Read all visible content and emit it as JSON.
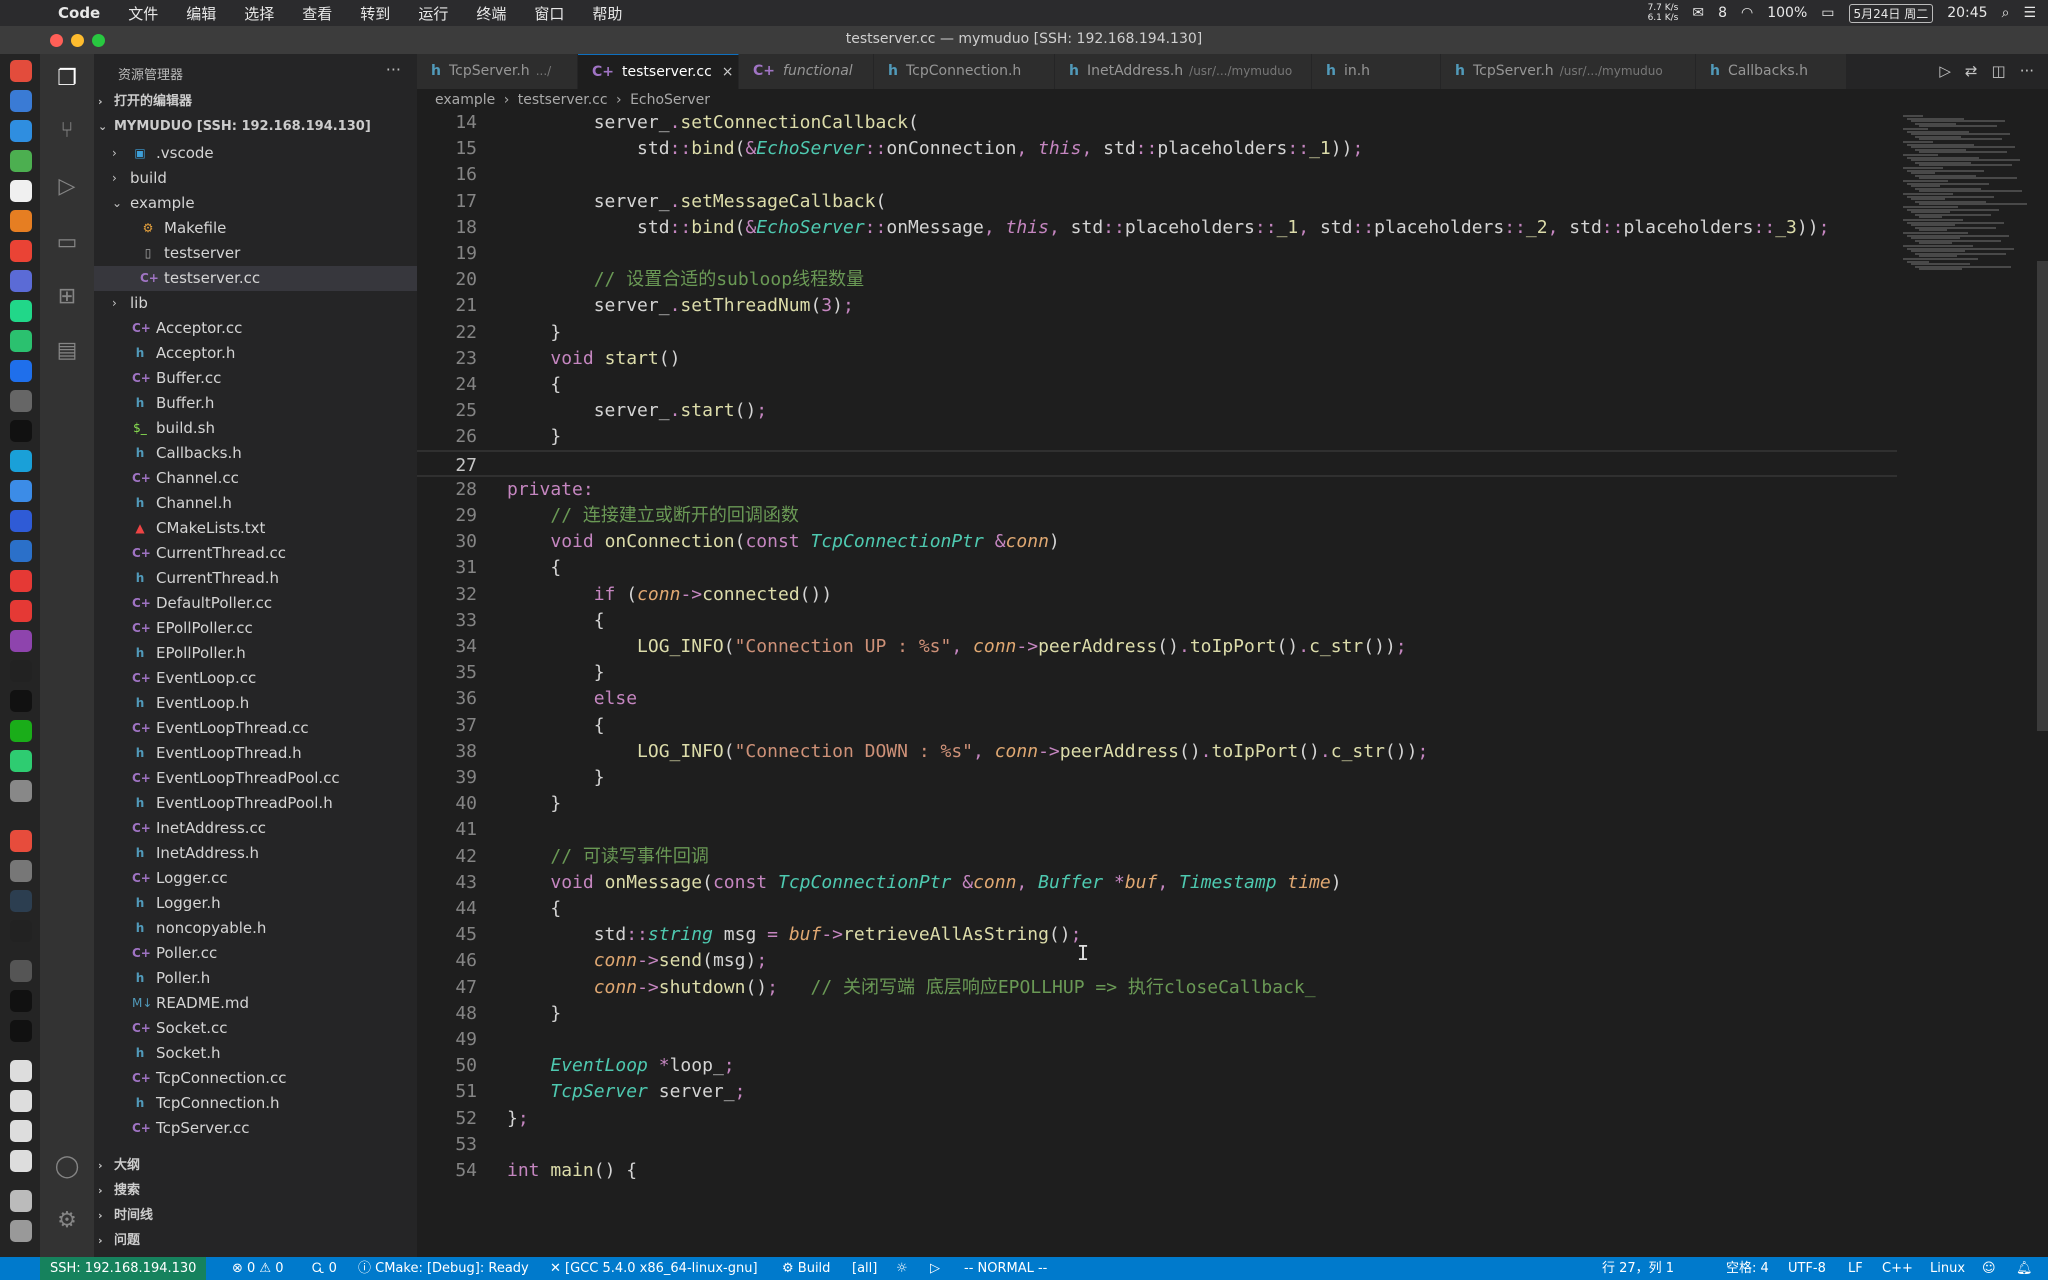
{
  "macbar": {
    "apple": "",
    "app_name": "Code",
    "menus": [
      "文件",
      "编辑",
      "选择",
      "查看",
      "转到",
      "运行",
      "终端",
      "窗口",
      "帮助"
    ],
    "net_speed_up": "7.7 K/s",
    "net_speed_down": "6.1 K/s",
    "wechat_count": "8",
    "battery": "100%",
    "date": "5月24日 周二",
    "time": "20:45"
  },
  "window": {
    "title": "testserver.cc — mymuduo [SSH: 192.168.194.130]"
  },
  "sidebar": {
    "title": "资源管理器",
    "more": "···",
    "open_editors": "打开的编辑器",
    "workspace": "MYMUDUO [SSH: 192.168.194.130]",
    "tree": [
      {
        "label": ".vscode",
        "kind": "folder-vscode",
        "depth": 1,
        "chev": "›"
      },
      {
        "label": "build",
        "kind": "folder",
        "depth": 1,
        "chev": "›"
      },
      {
        "label": "example",
        "kind": "folder",
        "depth": 1,
        "chev": "⌄"
      },
      {
        "label": "Makefile",
        "kind": "gear",
        "depth": 2
      },
      {
        "label": "testserver",
        "kind": "file",
        "depth": 2
      },
      {
        "label": "testserver.cc",
        "kind": "cc",
        "depth": 2,
        "selected": true
      },
      {
        "label": "lib",
        "kind": "folder",
        "depth": 1,
        "chev": "›"
      },
      {
        "label": "Acceptor.cc",
        "kind": "cc",
        "depth": 1
      },
      {
        "label": "Acceptor.h",
        "kind": "h",
        "depth": 1
      },
      {
        "label": "Buffer.cc",
        "kind": "cc",
        "depth": 1
      },
      {
        "label": "Buffer.h",
        "kind": "h",
        "depth": 1
      },
      {
        "label": "build.sh",
        "kind": "sh",
        "depth": 1
      },
      {
        "label": "Callbacks.h",
        "kind": "h",
        "depth": 1
      },
      {
        "label": "Channel.cc",
        "kind": "cc",
        "depth": 1
      },
      {
        "label": "Channel.h",
        "kind": "h",
        "depth": 1
      },
      {
        "label": "CMakeLists.txt",
        "kind": "cmake",
        "depth": 1
      },
      {
        "label": "CurrentThread.cc",
        "kind": "cc",
        "depth": 1
      },
      {
        "label": "CurrentThread.h",
        "kind": "h",
        "depth": 1
      },
      {
        "label": "DefaultPoller.cc",
        "kind": "cc",
        "depth": 1
      },
      {
        "label": "EPollPoller.cc",
        "kind": "cc",
        "depth": 1
      },
      {
        "label": "EPollPoller.h",
        "kind": "h",
        "depth": 1
      },
      {
        "label": "EventLoop.cc",
        "kind": "cc",
        "depth": 1
      },
      {
        "label": "EventLoop.h",
        "kind": "h",
        "depth": 1
      },
      {
        "label": "EventLoopThread.cc",
        "kind": "cc",
        "depth": 1
      },
      {
        "label": "EventLoopThread.h",
        "kind": "h",
        "depth": 1
      },
      {
        "label": "EventLoopThreadPool.cc",
        "kind": "cc",
        "depth": 1
      },
      {
        "label": "EventLoopThreadPool.h",
        "kind": "h",
        "depth": 1
      },
      {
        "label": "InetAddress.cc",
        "kind": "cc",
        "depth": 1
      },
      {
        "label": "InetAddress.h",
        "kind": "h",
        "depth": 1
      },
      {
        "label": "Logger.cc",
        "kind": "cc",
        "depth": 1
      },
      {
        "label": "Logger.h",
        "kind": "h",
        "depth": 1
      },
      {
        "label": "noncopyable.h",
        "kind": "h",
        "depth": 1
      },
      {
        "label": "Poller.cc",
        "kind": "cc",
        "depth": 1
      },
      {
        "label": "Poller.h",
        "kind": "h",
        "depth": 1
      },
      {
        "label": "README.md",
        "kind": "md",
        "depth": 1
      },
      {
        "label": "Socket.cc",
        "kind": "cc",
        "depth": 1
      },
      {
        "label": "Socket.h",
        "kind": "h",
        "depth": 1
      },
      {
        "label": "TcpConnection.cc",
        "kind": "cc",
        "depth": 1
      },
      {
        "label": "TcpConnection.h",
        "kind": "h",
        "depth": 1
      },
      {
        "label": "TcpServer.cc",
        "kind": "cc",
        "depth": 1
      }
    ],
    "bottom_sections": [
      "大纲",
      "搜索",
      "时间线",
      "问题"
    ]
  },
  "tabs": [
    {
      "label": "TcpServer.h",
      "path": ".../",
      "icon": "h"
    },
    {
      "label": "testserver.cc",
      "path": "",
      "icon": "cc",
      "active": true,
      "close": "×"
    },
    {
      "label": "functional",
      "path": "",
      "icon": "cc",
      "italic": true
    },
    {
      "label": "TcpConnection.h",
      "path": "",
      "icon": "h"
    },
    {
      "label": "InetAddress.h",
      "path": "/usr/.../mymuduo",
      "icon": "h"
    },
    {
      "label": "in.h",
      "path": "",
      "icon": "h"
    },
    {
      "label": "TcpServer.h",
      "path": "/usr/.../mymuduo",
      "icon": "h"
    },
    {
      "label": "Callbacks.h",
      "path": "",
      "icon": "h"
    }
  ],
  "breadcrumb": [
    "example",
    "›",
    "testserver.cc",
    "›",
    "EchoServer"
  ],
  "editor": {
    "current_line": 27,
    "lines": [
      {
        "n": 14,
        "code": "        server_.setConnectionCallback("
      },
      {
        "n": 15,
        "code": "            std::bind(&EchoServer::onConnection, this, std::placeholders::_1));"
      },
      {
        "n": 16,
        "code": ""
      },
      {
        "n": 17,
        "code": "        server_.setMessageCallback("
      },
      {
        "n": 18,
        "code": "            std::bind(&EchoServer::onMessage, this, std::placeholders::_1, std::placeholders::_2, std::placeholders::_3));"
      },
      {
        "n": 19,
        "code": ""
      },
      {
        "n": 20,
        "code": "        // 设置合适的subloop线程数量"
      },
      {
        "n": 21,
        "code": "        server_.setThreadNum(3);"
      },
      {
        "n": 22,
        "code": "    }"
      },
      {
        "n": 23,
        "code": "    void start()"
      },
      {
        "n": 24,
        "code": "    {"
      },
      {
        "n": 25,
        "code": "        server_.start();"
      },
      {
        "n": 26,
        "code": "    }"
      },
      {
        "n": 27,
        "code": ""
      },
      {
        "n": 28,
        "code": "private:"
      },
      {
        "n": 29,
        "code": "    // 连接建立或断开的回调函数"
      },
      {
        "n": 30,
        "code": "    void onConnection(const TcpConnectionPtr &conn)"
      },
      {
        "n": 31,
        "code": "    {"
      },
      {
        "n": 32,
        "code": "        if (conn->connected())"
      },
      {
        "n": 33,
        "code": "        {"
      },
      {
        "n": 34,
        "code": "            LOG_INFO(\"Connection UP : %s\", conn->peerAddress().toIpPort().c_str());"
      },
      {
        "n": 35,
        "code": "        }"
      },
      {
        "n": 36,
        "code": "        else"
      },
      {
        "n": 37,
        "code": "        {"
      },
      {
        "n": 38,
        "code": "            LOG_INFO(\"Connection DOWN : %s\", conn->peerAddress().toIpPort().c_str());"
      },
      {
        "n": 39,
        "code": "        }"
      },
      {
        "n": 40,
        "code": "    }"
      },
      {
        "n": 41,
        "code": ""
      },
      {
        "n": 42,
        "code": "    // 可读写事件回调"
      },
      {
        "n": 43,
        "code": "    void onMessage(const TcpConnectionPtr &conn, Buffer *buf, Timestamp time)"
      },
      {
        "n": 44,
        "code": "    {"
      },
      {
        "n": 45,
        "code": "        std::string msg = buf->retrieveAllAsString();"
      },
      {
        "n": 46,
        "code": "        conn->send(msg);"
      },
      {
        "n": 47,
        "code": "        conn->shutdown();   // 关闭写端 底层响应EPOLLHUP => 执行closeCallback_"
      },
      {
        "n": 48,
        "code": "    }"
      },
      {
        "n": 49,
        "code": ""
      },
      {
        "n": 50,
        "code": "    EventLoop *loop_;"
      },
      {
        "n": 51,
        "code": "    TcpServer server_;"
      },
      {
        "n": 52,
        "code": "};"
      },
      {
        "n": 53,
        "code": ""
      },
      {
        "n": 54,
        "code": "int main() {"
      }
    ]
  },
  "statusbar": {
    "remote": "SSH: 192.168.194.130",
    "errors": "⊗ 0 ⚠ 0",
    "ports": "Ꮹ 0",
    "cmake": "ⓘ CMake: [Debug]: Ready",
    "kit": "✕ [GCC 5.4.0 x86_64-linux-gnu]",
    "build": "⚙ Build",
    "target": "[all]",
    "vim_mode": "-- NORMAL --",
    "position": "行 27，列 1",
    "indent": "空格: 4",
    "encoding": "UTF-8",
    "eol": "LF",
    "language": "C++",
    "os": "Linux"
  }
}
